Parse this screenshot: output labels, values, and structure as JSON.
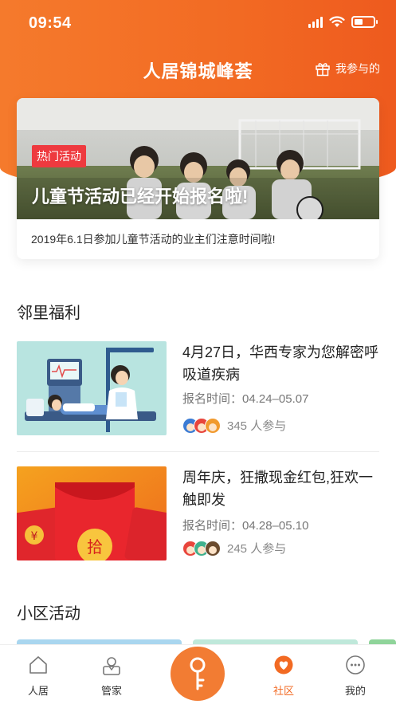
{
  "status_bar": {
    "time": "09:54",
    "battery_level": 0.45
  },
  "header": {
    "title": "人居锦城峰荟",
    "my_join_label": "我参与的",
    "my_join_icon": "gift-icon"
  },
  "banner": {
    "tag": "热门活动",
    "headline": "儿童节活动已经开始报名啦!",
    "description": "2019年6.1日参加儿童节活动的业主们注意时间啦!"
  },
  "welfare": {
    "section_title": "邻里福利",
    "items": [
      {
        "title": "4月27日，华西专家为您解密呼吸道疾病",
        "date": "报名时间：04.24–05.07",
        "count": "345 人参与"
      },
      {
        "title": "周年庆，狂撒现金红包,狂欢一触即发",
        "date": "报名时间：04.28–05.10",
        "count": "245 人参与"
      }
    ]
  },
  "activities": {
    "section_title": "小区活动"
  },
  "tabbar": {
    "items": [
      {
        "label": "人居",
        "icon": "home-icon"
      },
      {
        "label": "管家",
        "icon": "butler-icon"
      },
      {
        "label": "",
        "icon": "key-icon"
      },
      {
        "label": "社区",
        "icon": "community-heart-icon"
      },
      {
        "label": "我的",
        "icon": "profile-chat-icon"
      }
    ],
    "active_index": 3
  },
  "colors": {
    "accent": "#f26a23",
    "tag_red": "#ee3a3f"
  }
}
